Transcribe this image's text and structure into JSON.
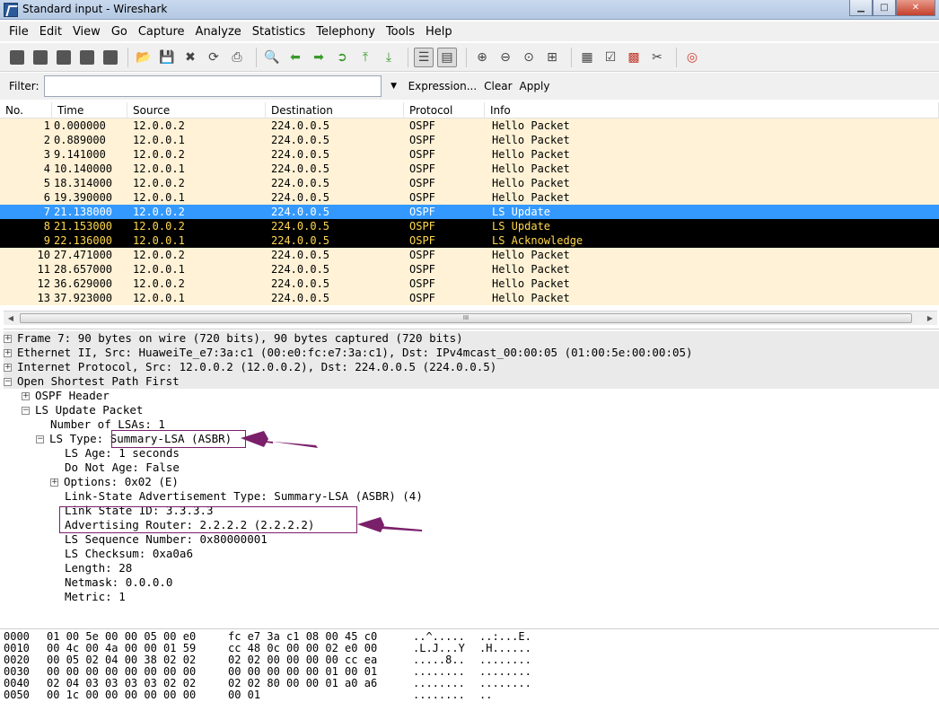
{
  "window": {
    "title": "Standard input - Wireshark",
    "minimize": "▁",
    "maximize": "□",
    "close": "✕"
  },
  "menu": [
    "File",
    "Edit",
    "View",
    "Go",
    "Capture",
    "Analyze",
    "Statistics",
    "Telephony",
    "Tools",
    "Help"
  ],
  "filter": {
    "label": "Filter:",
    "value": "",
    "dropdown": "▼",
    "expression": "Expression...",
    "clear": "Clear",
    "apply": "Apply"
  },
  "packet_list": {
    "columns": [
      "No.",
      "Time",
      "Source",
      "Destination",
      "Protocol",
      "Info"
    ],
    "rows": [
      {
        "no": "1",
        "time": "0.000000",
        "src": "12.0.0.2",
        "dst": "224.0.0.5",
        "proto": "OSPF",
        "info": "Hello Packet"
      },
      {
        "no": "2",
        "time": "0.889000",
        "src": "12.0.0.1",
        "dst": "224.0.0.5",
        "proto": "OSPF",
        "info": "Hello Packet"
      },
      {
        "no": "3",
        "time": "9.141000",
        "src": "12.0.0.2",
        "dst": "224.0.0.5",
        "proto": "OSPF",
        "info": "Hello Packet"
      },
      {
        "no": "4",
        "time": "10.140000",
        "src": "12.0.0.1",
        "dst": "224.0.0.5",
        "proto": "OSPF",
        "info": "Hello Packet"
      },
      {
        "no": "5",
        "time": "18.314000",
        "src": "12.0.0.2",
        "dst": "224.0.0.5",
        "proto": "OSPF",
        "info": "Hello Packet"
      },
      {
        "no": "6",
        "time": "19.390000",
        "src": "12.0.0.1",
        "dst": "224.0.0.5",
        "proto": "OSPF",
        "info": "Hello Packet"
      },
      {
        "no": "7",
        "time": "21.138000",
        "src": "12.0.0.2",
        "dst": "224.0.0.5",
        "proto": "OSPF",
        "info": "LS Update"
      },
      {
        "no": "8",
        "time": "21.153000",
        "src": "12.0.0.2",
        "dst": "224.0.0.5",
        "proto": "OSPF",
        "info": "LS Update"
      },
      {
        "no": "9",
        "time": "22.136000",
        "src": "12.0.0.1",
        "dst": "224.0.0.5",
        "proto": "OSPF",
        "info": "LS Acknowledge"
      },
      {
        "no": "10",
        "time": "27.471000",
        "src": "12.0.0.2",
        "dst": "224.0.0.5",
        "proto": "OSPF",
        "info": "Hello Packet"
      },
      {
        "no": "11",
        "time": "28.657000",
        "src": "12.0.0.1",
        "dst": "224.0.0.5",
        "proto": "OSPF",
        "info": "Hello Packet"
      },
      {
        "no": "12",
        "time": "36.629000",
        "src": "12.0.0.2",
        "dst": "224.0.0.5",
        "proto": "OSPF",
        "info": "Hello Packet"
      },
      {
        "no": "13",
        "time": "37.923000",
        "src": "12.0.0.1",
        "dst": "224.0.0.5",
        "proto": "OSPF",
        "info": "Hello Packet"
      }
    ]
  },
  "scrollbar": {
    "left": "◀",
    "right": "▶",
    "grip": "III"
  },
  "details": {
    "frame": "Frame 7: 90 bytes on wire (720 bits), 90 bytes captured (720 bits)",
    "ethernet": "Ethernet II, Src: HuaweiTe_e7:3a:c1 (00:e0:fc:e7:3a:c1), Dst: IPv4mcast_00:00:05 (01:00:5e:00:00:05)",
    "ip": "Internet Protocol, Src: 12.0.0.2 (12.0.0.2), Dst: 224.0.0.5 (224.0.0.5)",
    "ospf": "Open Shortest Path First",
    "ospf_header": "OSPF Header",
    "ls_update": "LS Update Packet",
    "num_lsas": "Number of LSAs: 1",
    "ls_type_prefix": "LS Type: ",
    "ls_type_value": "Summary-LSA (ASBR)",
    "ls_age": "LS Age: 1 seconds",
    "do_not_age": "Do Not Age: False",
    "options": "Options: 0x02 (E)",
    "lsa_type": "Link-State Advertisement Type: Summary-LSA (ASBR) (4)",
    "link_state_id": "Link State ID: 3.3.3.3",
    "adv_router": "Advertising Router: 2.2.2.2 (2.2.2.2)",
    "seq": "LS Sequence Number: 0x80000001",
    "checksum": "LS Checksum: 0xa0a6",
    "length": "Length: 28",
    "netmask": "Netmask: 0.0.0.0",
    "metric": "Metric: 1",
    "expanded": "⊟",
    "collapsed": "⊞"
  },
  "hex": [
    {
      "off": "0000",
      "h1": "01 00 5e 00 00 05 00 e0",
      "h2": "fc e7 3a c1 08 00 45 c0",
      "a1": "..^.....",
      "a2": "..:...E."
    },
    {
      "off": "0010",
      "h1": "00 4c 00 4a 00 00 01 59",
      "h2": "cc 48 0c 00 00 02 e0 00",
      "a1": ".L.J...Y",
      "a2": ".H......"
    },
    {
      "off": "0020",
      "h1": "00 05 02 04 00 38 02 02",
      "h2": "02 02 00 00 00 00 cc ea",
      "a1": ".....8..",
      "a2": "........"
    },
    {
      "off": "0030",
      "h1": "00 00 00 00 00 00 00 00",
      "h2": "00 00 00 00 00 01 00 01",
      "a1": "........",
      "a2": "........"
    },
    {
      "off": "0040",
      "h1": "02 04 03 03 03 03 02 02",
      "h2": "02 02 80 00 00 01 a0 a6",
      "a1": "........",
      "a2": "........"
    },
    {
      "off": "0050",
      "h1": "00 1c 00 00 00 00 00 00",
      "h2": "00 01",
      "a1": "........",
      "a2": ".."
    }
  ],
  "colors": {
    "row_normal": "#fff2d6",
    "row_selected": "#3399ff",
    "row_marked": "#000000",
    "marked_text": "#ffd84d",
    "annotation": "#7a1f6a"
  }
}
